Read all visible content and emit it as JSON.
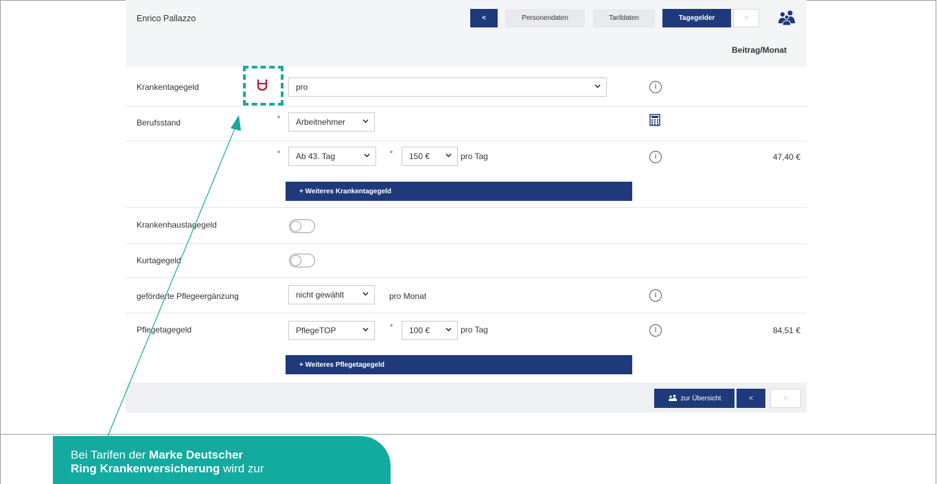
{
  "header": {
    "user_name": "Enrico Pallazzo",
    "back_label": "<",
    "tabs": [
      "Personendaten",
      "Tarifdaten",
      "Tagegelder"
    ],
    "next_label": ">"
  },
  "column_header": "Beitrag/Monat",
  "rows": {
    "krankentagegeld": {
      "label": "Krankentagegeld",
      "selected": "pro"
    },
    "berufsstand": {
      "label": "Berufsstand",
      "star": "*",
      "selected": "Arbeitnehmer"
    },
    "ktg_detail": {
      "star1": "*",
      "start_selected": "Ab 43. Tag",
      "star2": "*",
      "amount_selected": "150 €",
      "unit": "pro Tag",
      "price": "47,40 €"
    },
    "add_ktg_label": "+ Weiteres Krankentagegeld",
    "krankenhaustagegeld": {
      "label": "Krankenhaustagegeld"
    },
    "kurtagegeld": {
      "label": "Kurtagegeld"
    },
    "pflegeergaenzung": {
      "label": "geförderte Pflegeergänzung",
      "selected": "nicht gewählt",
      "unit": "pro Monat"
    },
    "pflegetagegeld": {
      "label": "Pflegetagegeld",
      "selected": "PflegeTOP",
      "star": "*",
      "amount_selected": "100 €",
      "unit": "pro Tag",
      "price": "84,51 €"
    },
    "add_ptg_label": "+ Weiteres Pflegetagegeld"
  },
  "footer": {
    "overview_label": "zur Übersicht",
    "back_label": "<",
    "next_label": ">"
  },
  "callout": {
    "text_before": "Bei Tarifen der ",
    "bold_1": "Marke Deutscher",
    "bold_2": "Ring Krankenversicherung",
    "text_after": " wird zur"
  },
  "colors": {
    "primary": "#1f3a7a",
    "teal": "#13aa9f",
    "brand_icon": "#b01f3a"
  },
  "icons": [
    "info-icon",
    "calculator-icon",
    "group-icon",
    "brand-icon"
  ]
}
